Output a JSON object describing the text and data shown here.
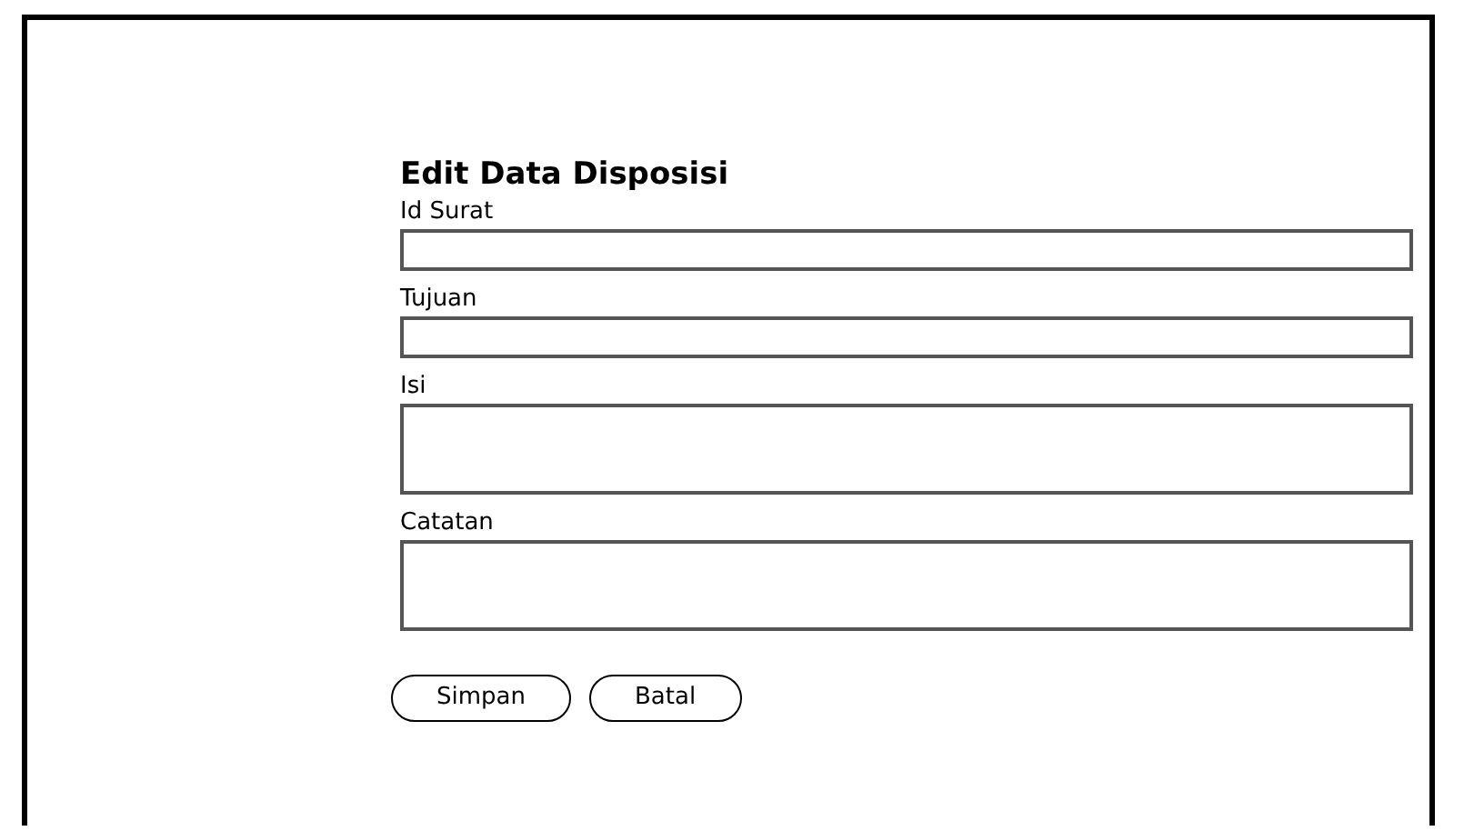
{
  "form": {
    "title": "Edit Data Disposisi",
    "fields": [
      {
        "label": "Id Surat",
        "kind": "input"
      },
      {
        "label": "Tujuan",
        "kind": "input"
      },
      {
        "label": "Isi",
        "kind": "textarea"
      },
      {
        "label": "Catatan",
        "kind": "textarea"
      }
    ],
    "buttons": [
      "Simpan",
      "Batal"
    ]
  }
}
